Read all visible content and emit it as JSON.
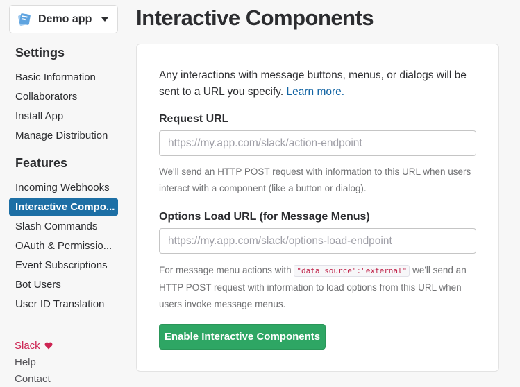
{
  "app_switcher": {
    "name": "Demo app"
  },
  "sidebar": {
    "settings_title": "Settings",
    "settings_items": [
      "Basic Information",
      "Collaborators",
      "Install App",
      "Manage Distribution"
    ],
    "features_title": "Features",
    "features_items": [
      "Incoming Webhooks",
      "Interactive Compo...",
      "Slash Commands",
      "OAuth & Permissio...",
      "Event Subscriptions",
      "Bot Users",
      "User ID Translation"
    ],
    "active_item": "Interactive Compo...",
    "footer": {
      "slack": "Slack",
      "help": "Help",
      "contact": "Contact"
    }
  },
  "page": {
    "title": "Interactive Components"
  },
  "card": {
    "intro_text": "Any interactions with message buttons, menus, or dialogs will be sent to a URL you specify.",
    "learn_more": "Learn more.",
    "request_url": {
      "label": "Request URL",
      "placeholder": "https://my.app.com/slack/action-endpoint",
      "help": "We'll send an HTTP POST request with information to this URL when users interact with a component (like a button or dialog)."
    },
    "options_url": {
      "label": "Options Load URL (for Message Menus)",
      "placeholder": "https://my.app.com/slack/options-load-endpoint",
      "help_before": "For message menu actions with",
      "help_code": "\"data_source\":\"external\"",
      "help_after": "we'll send an HTTP POST request with information to load options from this URL when users invoke message menus."
    },
    "enable_button": "Enable Interactive Components"
  },
  "colors": {
    "active_nav": "#1d6fa5",
    "button": "#2ea664",
    "link": "#1264a3",
    "slack_heart": "#cd2553"
  }
}
